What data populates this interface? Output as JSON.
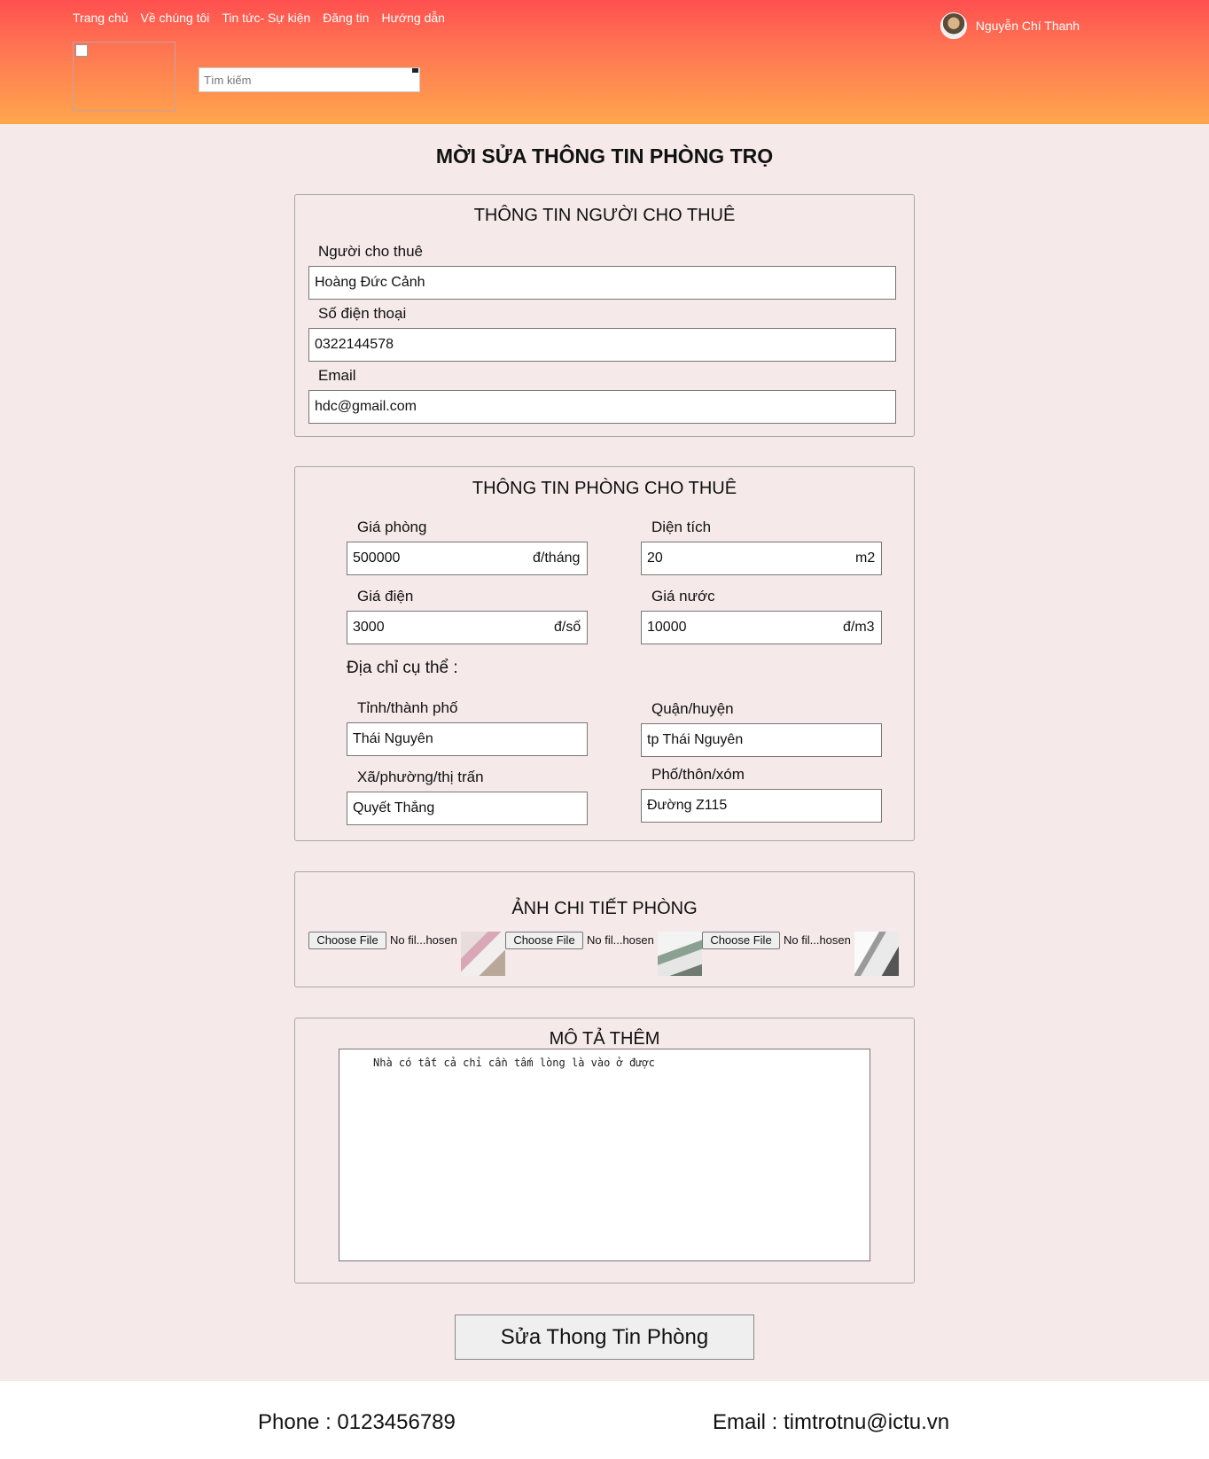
{
  "nav": {
    "items": [
      "Trang chủ",
      "Về chúng tôi",
      "Tin tức- Sự kiện",
      "Đăng tin",
      "Hướng dẫn"
    ]
  },
  "user": {
    "name": "Nguyễn Chí Thanh"
  },
  "search": {
    "placeholder": "Tìm kiếm"
  },
  "page_title": "MỜI SỬA THÔNG TIN PHÒNG TRỌ",
  "owner": {
    "title": "THÔNG TIN NGƯỜI CHO THUÊ",
    "name_label": "Người cho thuê",
    "name": "Hoàng Đức Cảnh",
    "phone_label": "Số điện thoại",
    "phone": "0322144578",
    "email_label": "Email",
    "email": "hdc@gmail.com"
  },
  "room": {
    "title": "THÔNG TIN PHÒNG CHO THUÊ",
    "price_label": "Giá phòng",
    "price": "500000",
    "price_unit": "đ/tháng",
    "area_label": "Diện tích",
    "area": "20",
    "area_unit": "m2",
    "electric_label": "Giá điện",
    "electric": "3000",
    "electric_unit": "đ/số",
    "water_label": "Giá nước",
    "water": "10000",
    "water_unit": "đ/m3",
    "address_label": "Địa chỉ cụ thể :",
    "province_label": "Tỉnh/thành phố",
    "province": "Thái Nguyên",
    "district_label": "Quận/huyện",
    "district": "tp Thái Nguyên",
    "ward_label": "Xã/phường/thị trấn",
    "ward": "Quyết Thắng",
    "street_label": "Phố/thôn/xóm",
    "street": "Đường Z115"
  },
  "photos": {
    "title": "ẢNH CHI TIẾT PHÒNG",
    "choose_label": "Choose File",
    "no_file_text": "No fil...hosen"
  },
  "description": {
    "title": "MÔ TẢ THÊM",
    "text": "Nhà có tất cả chỉ cần tấm lòng là vào ở được"
  },
  "submit_label": "Sửa Thong Tin Phòng",
  "footer": {
    "phone": "Phone : 0123456789",
    "email": "Email :  timtrotnu@ictu.vn"
  }
}
